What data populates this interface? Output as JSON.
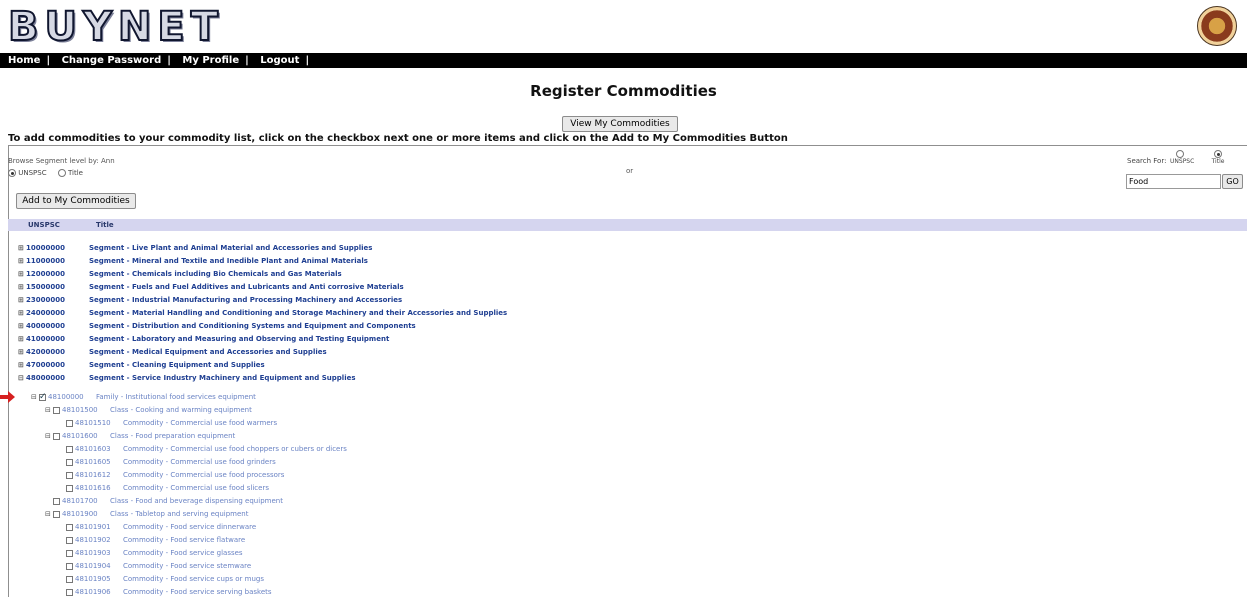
{
  "brand": {
    "title": "BUYNET"
  },
  "nav": {
    "items": [
      "Home",
      "Change Password",
      "My Profile",
      "Logout"
    ]
  },
  "page": {
    "title": "Register Commodities"
  },
  "actions": {
    "view_my_commodities": "View My Commodities",
    "add_to_my_commodities": "Add to My Commodities"
  },
  "instructions": "To add commodities to your commodity list, click on the checkbox next one or more items and click on the Add to My Commodities Button",
  "browse": {
    "label": "Browse Segment level by: Ann",
    "options": [
      "UNSPSC",
      "Title"
    ],
    "selected": "UNSPSC"
  },
  "or_text": "or",
  "search": {
    "label": "Search For:",
    "options": [
      "UNSPSC",
      "Title"
    ],
    "selected": "Title",
    "value": "Food",
    "button": "GO"
  },
  "table": {
    "headers": [
      "UNSPSC",
      "Title"
    ]
  },
  "segments": [
    {
      "code": "10000000",
      "title": "Segment - Live Plant and Animal Material and Accessories and Supplies"
    },
    {
      "code": "11000000",
      "title": "Segment - Mineral and Textile and Inedible Plant and Animal Materials"
    },
    {
      "code": "12000000",
      "title": "Segment - Chemicals including Bio Chemicals and Gas Materials"
    },
    {
      "code": "15000000",
      "title": "Segment - Fuels and Fuel Additives and Lubricants and Anti corrosive Materials"
    },
    {
      "code": "23000000",
      "title": "Segment - Industrial Manufacturing and Processing Machinery and Accessories"
    },
    {
      "code": "24000000",
      "title": "Segment - Material Handling and Conditioning and Storage Machinery and their Accessories and Supplies"
    },
    {
      "code": "40000000",
      "title": "Segment - Distribution and Conditioning Systems and Equipment and Components"
    },
    {
      "code": "41000000",
      "title": "Segment - Laboratory and Measuring and Observing and Testing Equipment"
    },
    {
      "code": "42000000",
      "title": "Segment - Medical Equipment and Accessories and Supplies"
    },
    {
      "code": "47000000",
      "title": "Segment - Cleaning Equipment and Supplies"
    },
    {
      "code": "48000000",
      "title": "Segment - Service Industry Machinery and Equipment and Supplies",
      "expanded": true
    }
  ],
  "children": [
    {
      "level": 1,
      "code": "48100000",
      "title": "Family - Institutional food services equipment",
      "checked": true,
      "expander": "⊟"
    },
    {
      "level": 2,
      "code": "48101500",
      "title": "Class - Cooking and warming equipment",
      "checked": false,
      "expander": "⊟"
    },
    {
      "level": 3,
      "code": "48101510",
      "title": "Commodity - Commercial use food warmers",
      "checked": false,
      "expander": ""
    },
    {
      "level": 2,
      "code": "48101600",
      "title": "Class - Food preparation equipment",
      "checked": false,
      "expander": "⊟"
    },
    {
      "level": 3,
      "code": "48101603",
      "title": "Commodity - Commercial use food choppers or cubers or dicers",
      "checked": false,
      "expander": ""
    },
    {
      "level": 3,
      "code": "48101605",
      "title": "Commodity - Commercial use food grinders",
      "checked": false,
      "expander": ""
    },
    {
      "level": 3,
      "code": "48101612",
      "title": "Commodity - Commercial use food processors",
      "checked": false,
      "expander": ""
    },
    {
      "level": 3,
      "code": "48101616",
      "title": "Commodity - Commercial use food slicers",
      "checked": false,
      "expander": ""
    },
    {
      "level": 2,
      "code": "48101700",
      "title": "Class - Food and beverage dispensing equipment",
      "checked": false,
      "expander": ""
    },
    {
      "level": 2,
      "code": "48101900",
      "title": "Class - Tabletop and serving equipment",
      "checked": false,
      "expander": "⊟"
    },
    {
      "level": 3,
      "code": "48101901",
      "title": "Commodity - Food service dinnerware",
      "checked": false,
      "expander": ""
    },
    {
      "level": 3,
      "code": "48101902",
      "title": "Commodity - Food service flatware",
      "checked": false,
      "expander": ""
    },
    {
      "level": 3,
      "code": "48101903",
      "title": "Commodity - Food service glasses",
      "checked": false,
      "expander": ""
    },
    {
      "level": 3,
      "code": "48101904",
      "title": "Commodity - Food service stemware",
      "checked": false,
      "expander": ""
    },
    {
      "level": 3,
      "code": "48101905",
      "title": "Commodity - Food service cups or mugs",
      "checked": false,
      "expander": ""
    },
    {
      "level": 3,
      "code": "48101906",
      "title": "Commodity - Food service serving baskets",
      "checked": false,
      "expander": ""
    }
  ],
  "colors": {
    "nav_bg": "#000000",
    "header_bar": "#d5d5ef",
    "link": "#1f3f92",
    "child_link": "#6a83c4",
    "arrow": "#d62020"
  }
}
